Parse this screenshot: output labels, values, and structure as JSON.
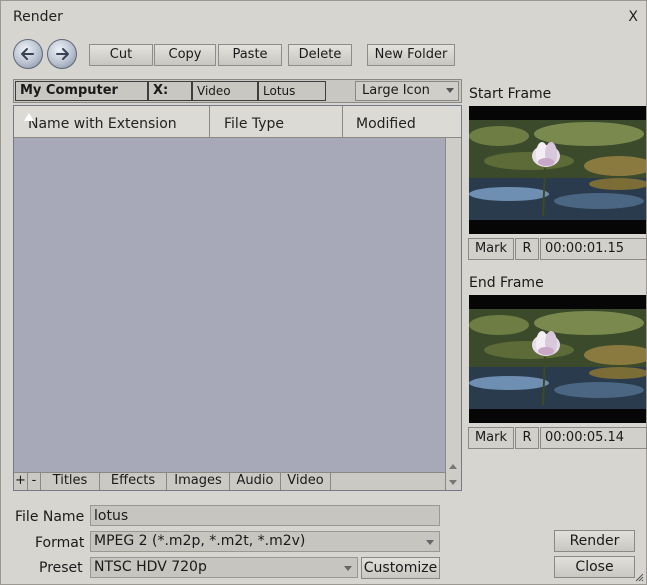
{
  "window": {
    "title": "Render",
    "close_label": "X"
  },
  "toolbar": {
    "cut": "Cut",
    "copy": "Copy",
    "paste": "Paste",
    "delete": "Delete",
    "new_folder": "New Folder"
  },
  "path": {
    "crumbs": [
      "My Computer",
      "X:",
      "Video",
      "Lotus"
    ],
    "view_mode": "Large Icon"
  },
  "file_list": {
    "columns": [
      "Name with Extension",
      "File Type",
      "Modified"
    ],
    "tabs": [
      "+",
      "-",
      "Titles",
      "Effects",
      "Images",
      "Audio",
      "Video"
    ]
  },
  "start_frame": {
    "label": "Start Frame",
    "mark": "Mark",
    "r": "R",
    "timecode": "00:00:01.15"
  },
  "end_frame": {
    "label": "End Frame",
    "mark": "Mark",
    "r": "R",
    "timecode": "00:00:05.14"
  },
  "form": {
    "file_name_label": "File Name",
    "file_name_value": "lotus",
    "format_label": "Format",
    "format_value": "MPEG 2 (*.m2p, *.m2t, *.m2v)",
    "preset_label": "Preset",
    "preset_value": "NTSC HDV 720p",
    "customize": "Customize"
  },
  "actions": {
    "render": "Render",
    "close": "Close"
  }
}
